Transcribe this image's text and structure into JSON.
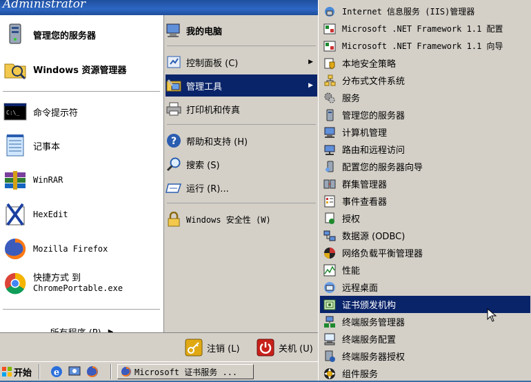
{
  "header": {
    "user_name": "Administrator"
  },
  "left_items": [
    {
      "label": "管理您的服务器",
      "icon": "server-icon",
      "bold": true
    },
    {
      "label": "Windows 资源管理器",
      "icon": "explorer-icon",
      "bold": true
    },
    {
      "label": "命令提示符",
      "icon": "command-prompt-icon"
    },
    {
      "label": "记事本",
      "icon": "notepad-icon"
    },
    {
      "label": "WinRAR",
      "icon": "winrar-icon"
    },
    {
      "label": "HexEdit",
      "icon": "hexedit-icon"
    },
    {
      "label": "Mozilla Firefox",
      "icon": "firefox-icon"
    },
    {
      "label": "快捷方式 到",
      "sublabel": "ChromePortable.exe",
      "icon": "chrome-icon"
    }
  ],
  "all_programs": "所有程序 (P)",
  "right_items": [
    {
      "label": "我的电脑",
      "icon": "my-computer-icon",
      "bold": true
    },
    {
      "label": "控制面板 (C)",
      "icon": "control-panel-icon",
      "arrow": true
    },
    {
      "label": "管理工具",
      "icon": "admin-tools-icon",
      "arrow": true,
      "highlighted": true
    },
    {
      "label": "打印机和传真",
      "icon": "printer-icon"
    },
    {
      "label": "帮助和支持 (H)",
      "icon": "help-icon"
    },
    {
      "label": "搜索 (S)",
      "icon": "search-icon"
    },
    {
      "label": "运行 (R)...",
      "icon": "run-icon"
    },
    {
      "label": "Windows 安全性 (W)",
      "icon": "lock-icon"
    }
  ],
  "footer": {
    "logoff": "注销 (L)",
    "shutdown": "关机 (U)"
  },
  "taskbar": {
    "start": "开始",
    "task_label": "Microsoft 证书服务 ..."
  },
  "submenu": [
    {
      "label": "Internet 信息服务 (IIS)管理器",
      "icon": "iis-icon"
    },
    {
      "label": "Microsoft .NET Framework 1.1 配置",
      "icon": "dotnet-config-icon"
    },
    {
      "label": "Microsoft .NET Framework 1.1 向导",
      "icon": "dotnet-wizard-icon"
    },
    {
      "label": "本地安全策略",
      "icon": "security-policy-icon"
    },
    {
      "label": "分布式文件系统",
      "icon": "dfs-icon"
    },
    {
      "label": "服务",
      "icon": "services-icon"
    },
    {
      "label": "管理您的服务器",
      "icon": "server-icon"
    },
    {
      "label": "计算机管理",
      "icon": "computer-management-icon"
    },
    {
      "label": "路由和远程访问",
      "icon": "routing-icon"
    },
    {
      "label": "配置您的服务器向导",
      "icon": "configure-server-icon"
    },
    {
      "label": "群集管理器",
      "icon": "cluster-icon"
    },
    {
      "label": "事件查看器",
      "icon": "event-viewer-icon"
    },
    {
      "label": "授权",
      "icon": "licensing-icon"
    },
    {
      "label": "数据源 (ODBC)",
      "icon": "odbc-icon"
    },
    {
      "label": "网络负载平衡管理器",
      "icon": "nlb-icon"
    },
    {
      "label": "性能",
      "icon": "performance-icon"
    },
    {
      "label": "远程桌面",
      "icon": "remote-desktop-icon"
    },
    {
      "label": "证书颁发机构",
      "icon": "certificate-icon",
      "highlighted": true
    },
    {
      "label": "终端服务管理器",
      "icon": "terminal-manager-icon"
    },
    {
      "label": "终端服务配置",
      "icon": "terminal-config-icon"
    },
    {
      "label": "终端服务器授权",
      "icon": "terminal-licensing-icon"
    },
    {
      "label": "组件服务",
      "icon": "component-services-icon"
    }
  ]
}
